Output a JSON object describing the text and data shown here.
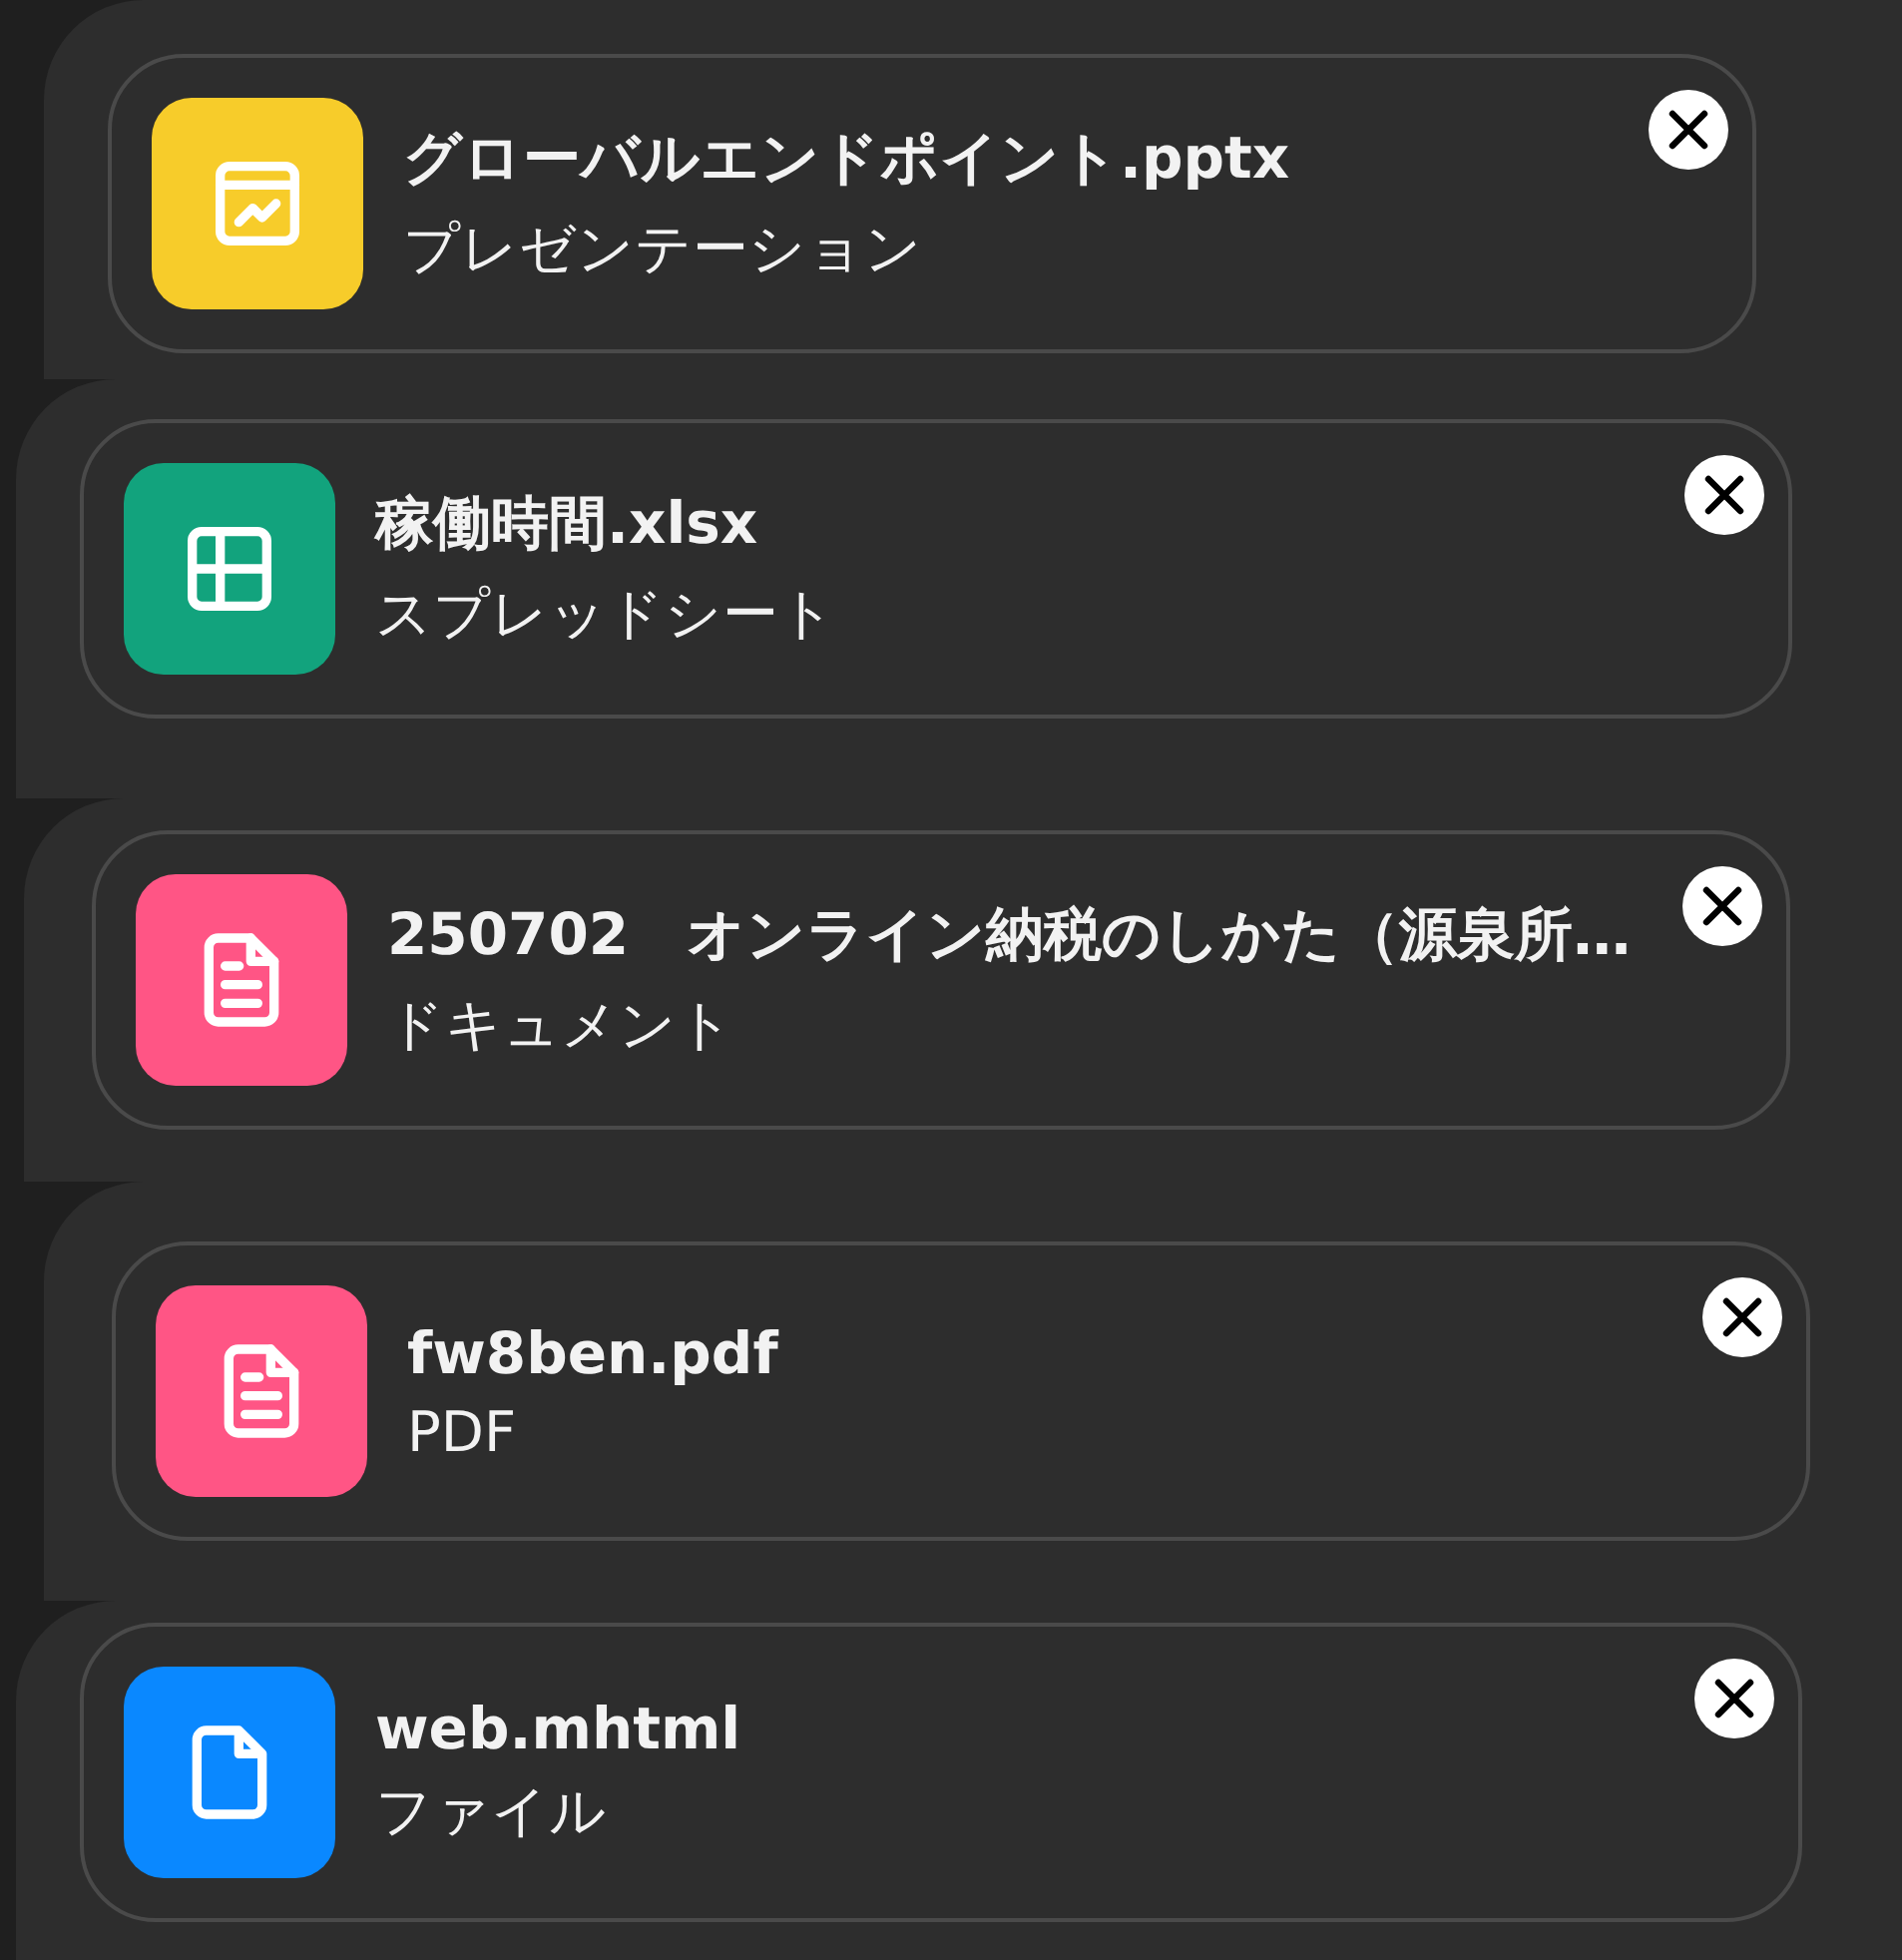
{
  "attachments": [
    {
      "name": "グローバルエンドポイント.pptx",
      "type_label": "プレゼンテーション",
      "kind": "presentation",
      "color": "#f7cc2a"
    },
    {
      "name": "稼働時間.xlsx",
      "type_label": "スプレッドシート",
      "kind": "spreadsheet",
      "color": "#12a37d"
    },
    {
      "name": "250702　オンライン納税のしかた（源泉所…",
      "type_label": "ドキュメント",
      "kind": "document",
      "color": "#ff5585"
    },
    {
      "name": "fw8ben.pdf",
      "type_label": "PDF",
      "kind": "document",
      "color": "#ff5585"
    },
    {
      "name": "web.mhtml",
      "type_label": "ファイル",
      "kind": "file",
      "color": "#0a88ff"
    }
  ]
}
